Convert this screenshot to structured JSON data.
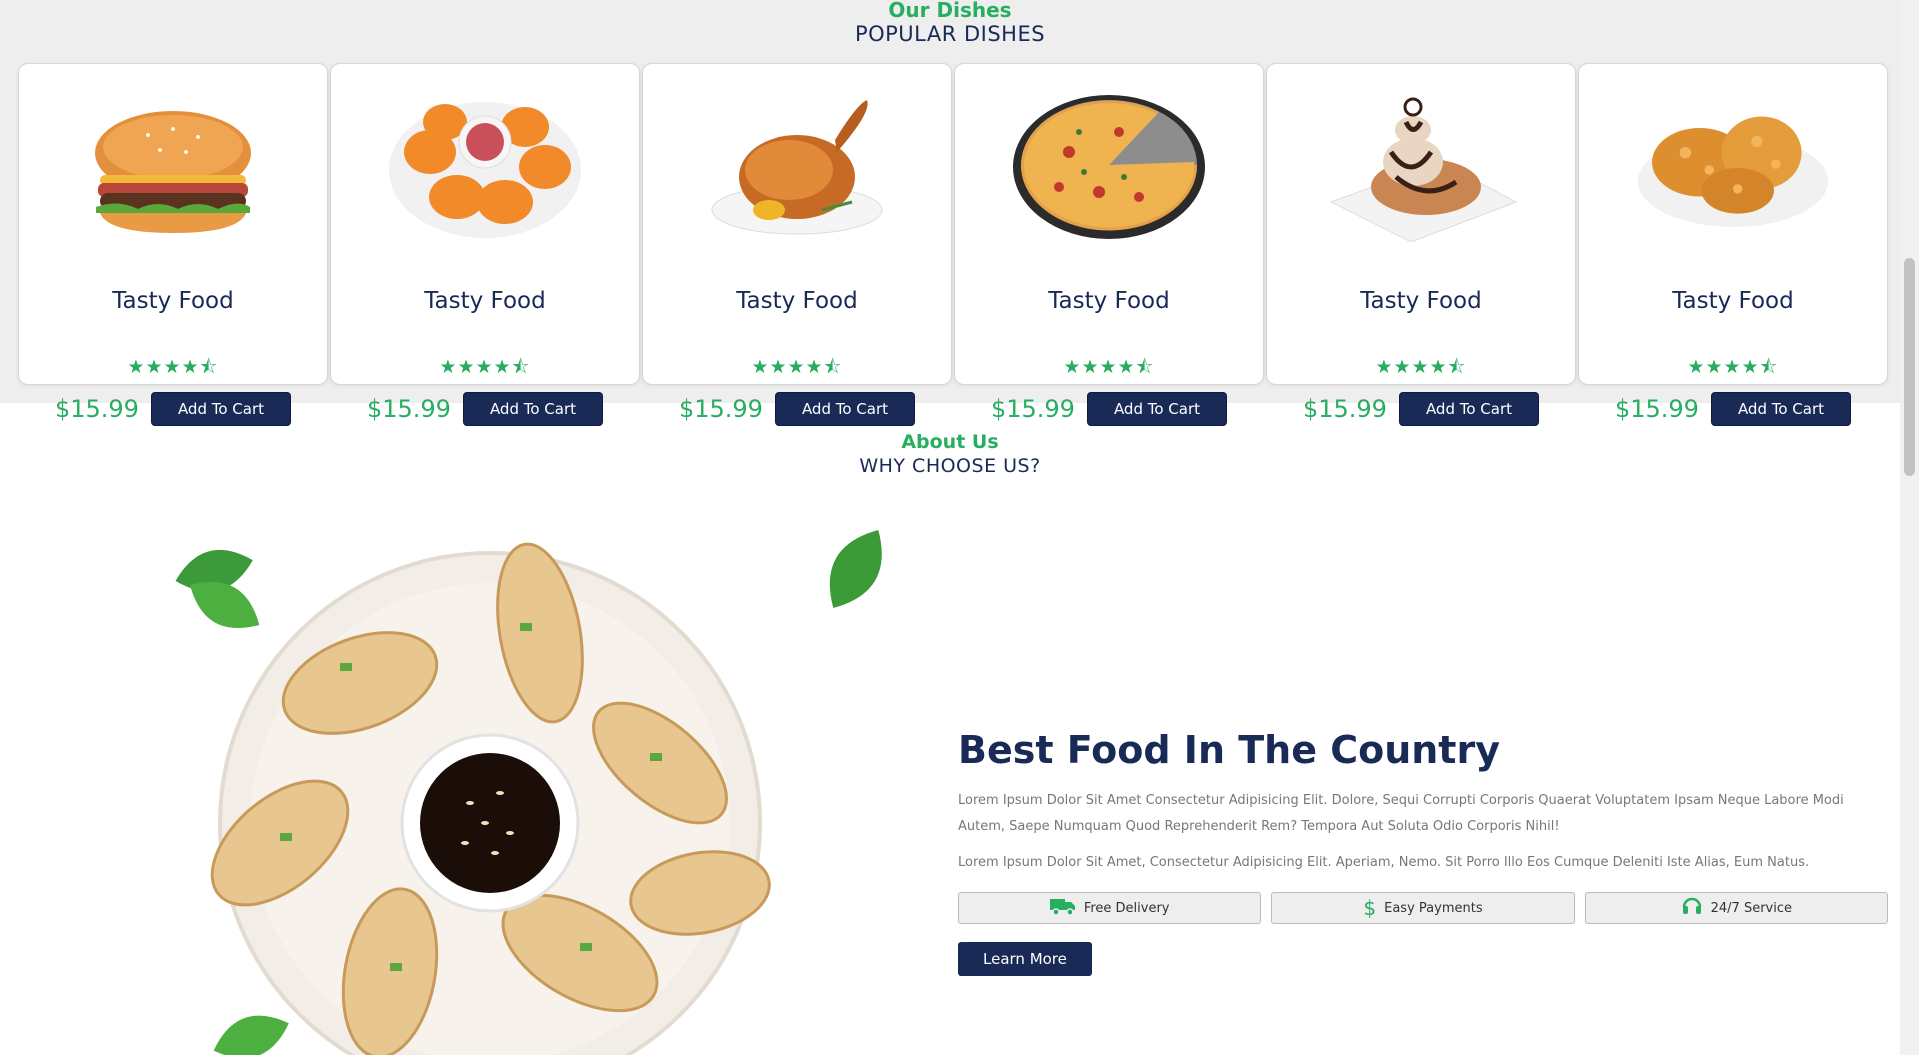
{
  "dishes_section": {
    "sub_title": "Our Dishes",
    "heading": "POPULAR DISHES",
    "cards": [
      {
        "name": "Tasty Food",
        "price": "$15.99",
        "button": "Add To Cart",
        "stars": "★★★★⯪",
        "image": "burger"
      },
      {
        "name": "Tasty Food",
        "price": "$15.99",
        "button": "Add To Cart",
        "stars": "★★★★⯪",
        "image": "nuggets"
      },
      {
        "name": "Tasty Food",
        "price": "$15.99",
        "button": "Add To Cart",
        "stars": "★★★★⯪",
        "image": "roast-chicken"
      },
      {
        "name": "Tasty Food",
        "price": "$15.99",
        "button": "Add To Cart",
        "stars": "★★★★⯪",
        "image": "pizza"
      },
      {
        "name": "Tasty Food",
        "price": "$15.99",
        "button": "Add To Cart",
        "stars": "★★★★⯪",
        "image": "dessert"
      },
      {
        "name": "Tasty Food",
        "price": "$15.99",
        "button": "Add To Cart",
        "stars": "★★★★⯪",
        "image": "fried-chicken"
      }
    ]
  },
  "about_section": {
    "sub_title": "About Us",
    "heading": "WHY CHOOSE US?",
    "title": "Best Food In The Country",
    "paragraph_1": "Lorem Ipsum Dolor Sit Amet Consectetur Adipisicing Elit. Dolore, Sequi Corrupti Corporis Quaerat Voluptatem Ipsam Neque Labore Modi Autem, Saepe Numquam Quod Reprehenderit Rem? Tempora Aut Soluta Odio Corporis Nihil!",
    "paragraph_2": "Lorem Ipsum Dolor Sit Amet, Consectetur Adipisicing Elit. Aperiam, Nemo. Sit Porro Illo Eos Cumque Deleniti Iste Alias, Eum Natus.",
    "features": [
      {
        "label": "Free Delivery",
        "icon": "truck-icon"
      },
      {
        "label": "Easy Payments",
        "icon": "dollar-icon"
      },
      {
        "label": "24/7 Service",
        "icon": "headset-icon"
      }
    ],
    "learn_more": "Learn More"
  },
  "colors": {
    "accent": "#27ae60",
    "primary": "#192a56",
    "section_bg": "#eeeeee"
  }
}
